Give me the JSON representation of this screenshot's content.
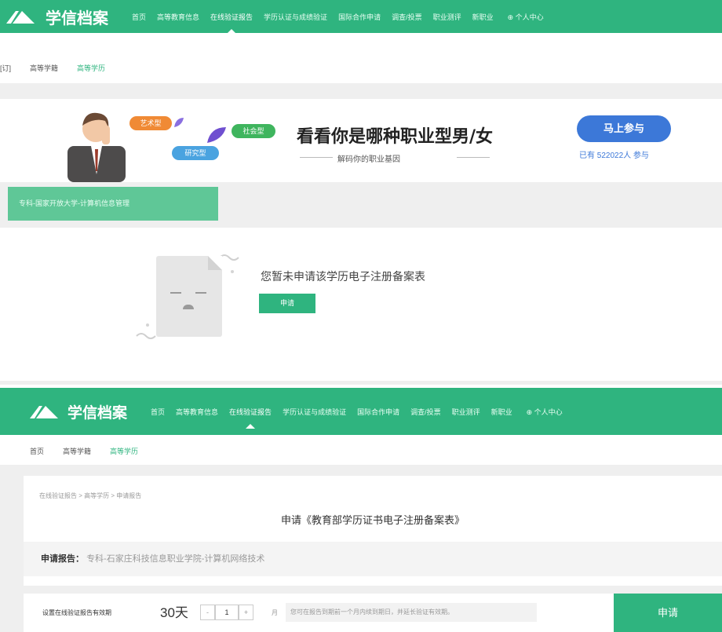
{
  "top_nav": {
    "logo_text": "学信档案",
    "items": [
      "首页",
      "高等教育信息",
      "在线验证报告",
      "学历认证与成绩验证",
      "国际合作申请",
      "调查/投票",
      "职业测评",
      "新职业",
      "⊕ 个人中心"
    ],
    "active_index": 2
  },
  "top_subnav": {
    "items": [
      "[订]",
      "高等学籍",
      "高等学历"
    ],
    "active_index": 2
  },
  "banner": {
    "headline": "看看你是哪种职业型男/女",
    "subline": "解码你的职业基因",
    "tags": [
      "艺术型",
      "社会型",
      "研究型"
    ],
    "join_label": "马上参与",
    "participants": "已有 522022人 参与"
  },
  "record_tab": "专科-国家开放大学-计算机信息管理",
  "empty_state": {
    "message": "您暂未申请该学历电子注册备案表",
    "apply_label": "申请"
  },
  "bottom_nav": {
    "logo_text": "学信档案",
    "items": [
      "首页",
      "高等教育信息",
      "在线验证报告",
      "学历认证与成绩验证",
      "国际合作申请",
      "调查/投票",
      "职业测评",
      "新职业",
      "⊕ 个人中心"
    ],
    "active_index": 2
  },
  "bottom_subnav": {
    "items": [
      "首页",
      "高等学籍",
      "高等学历"
    ],
    "active_index": 2
  },
  "application": {
    "breadcrumb": "在线验证报告 > 高等学历 > 申请报告",
    "title": "申请《教育部学历证书电子注册备案表》",
    "report_label": "申请报告：",
    "report_value": "专科-石家庄科技信息职业学院-计算机网络技术",
    "validity_label": "设置在线验证报告有效期",
    "validity_value": "30天",
    "stepper_minus": "-",
    "stepper_value": "1",
    "stepper_plus": "+",
    "unit": "月",
    "hint": "您可在报告到期前一个月内续到期日，并延长验证有效期。",
    "apply_label": "申请"
  },
  "colors": {
    "brand_green": "#2fb47f",
    "blue": "#3c78d8"
  }
}
